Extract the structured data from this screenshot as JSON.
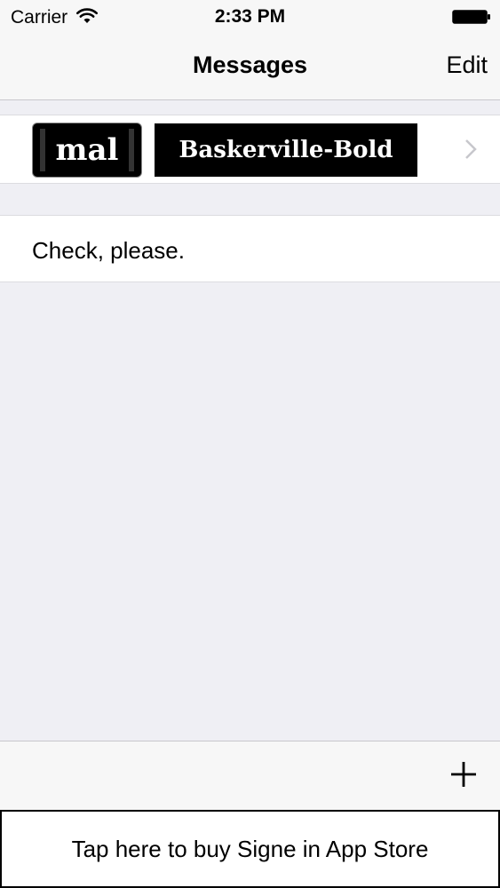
{
  "status_bar": {
    "carrier": "Carrier",
    "time": "2:33 PM",
    "wifi_icon": "wifi-icon",
    "battery_icon": "battery-icon"
  },
  "nav": {
    "title": "Messages",
    "edit_label": "Edit"
  },
  "font_row": {
    "thumb_text": "mal",
    "font_name": "Baskerville-Bold",
    "chevron_icon": "chevron-right-icon"
  },
  "message": {
    "text": "Check, please."
  },
  "toolbar": {
    "add_icon": "plus-icon"
  },
  "banner": {
    "text": "Tap here to buy Signe in App Store"
  },
  "colors": {
    "background": "#efeff4",
    "bar": "#f7f7f7",
    "separator": "#c8c7cc"
  }
}
